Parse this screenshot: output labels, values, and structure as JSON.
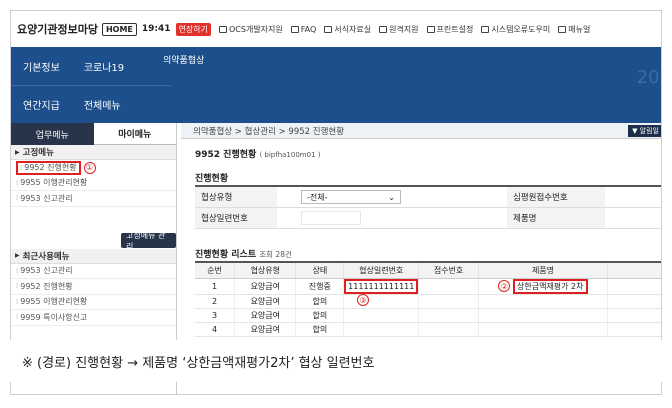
{
  "topbar": {
    "title": "요양기관정보마당",
    "home": "HOME",
    "time": "19:41",
    "extend": "연장하기",
    "links": [
      "OCS개발자지원",
      "FAQ",
      "서식자료실",
      "원격지원",
      "프린트설정",
      "시스템오류도우미",
      "매뉴얼"
    ]
  },
  "nav": {
    "row1": [
      "기본정보",
      "코로나19"
    ],
    "row2": [
      "연간지급",
      "전체메뉴"
    ],
    "sub": "의약품협상",
    "year": "202"
  },
  "sidebar": {
    "tabs": [
      "업무메뉴",
      "마이메뉴"
    ],
    "fixed_head": "고정메뉴",
    "fixed_items": [
      "9952 진행현황",
      "9955 이행관리현황",
      "9953 신고관리"
    ],
    "manage_btn": "고정메뉴 관리",
    "recent_head": "최근사용메뉴",
    "recent_items": [
      "9953 신고관리",
      "9952 진행현황",
      "9955 이행관리현황",
      "9959 특이사항신고"
    ]
  },
  "main": {
    "breadcrumb": "의약품협상 > 협상관리 > 9952 진행현황",
    "alarm": "▼ 알림일",
    "page_title": "9952 진행현황",
    "page_code": "( bipfha100m01 )",
    "search_title": "진행현황",
    "form": {
      "label_type": "협상유형",
      "select_value": "-전체-",
      "label_receipt": "심평원접수번호",
      "label_serial": "협상일련번호",
      "label_product": "제품명"
    },
    "list_title": "진행현황 리스트",
    "list_count": "조회 28건",
    "columns": [
      "순번",
      "협상유형",
      "상태",
      "협상일련번호",
      "접수번호",
      "제품명"
    ],
    "rows": [
      {
        "no": "1",
        "type": "요양급여",
        "status": "진행중",
        "serial": "1111111111111",
        "receipt": "",
        "product": "상한금액재평가 2차"
      },
      {
        "no": "2",
        "type": "요양급여",
        "status": "합의",
        "serial": "",
        "receipt": "",
        "product": ""
      },
      {
        "no": "3",
        "type": "요양급여",
        "status": "합의",
        "serial": "",
        "receipt": "",
        "product": ""
      },
      {
        "no": "4",
        "type": "요양급여",
        "status": "합의",
        "serial": "",
        "receipt": "",
        "product": ""
      }
    ],
    "markers": [
      "①",
      "②",
      "③"
    ]
  },
  "note": "※ (경로) 진행현황 → 제품명 ‘상한금액재평가2차’ 협상 일련번호",
  "colors": {
    "nav": "#1c4f8c",
    "sidebar_tab": "#27344a",
    "highlight": "#e02020",
    "extend": "#e0312b"
  }
}
